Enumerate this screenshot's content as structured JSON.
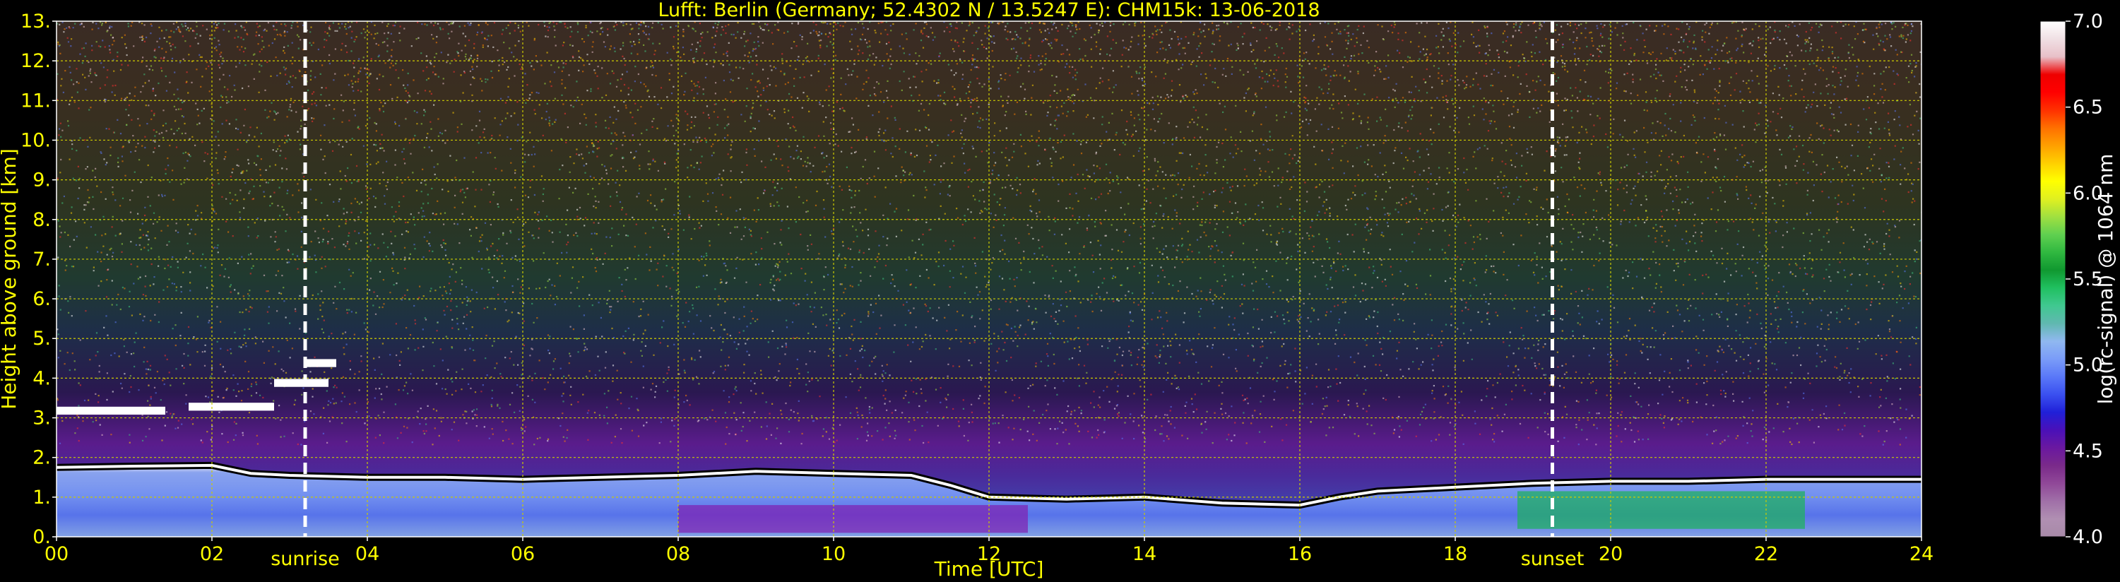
{
  "chart_data": {
    "type": "heatmap",
    "title": "Lufft: Berlin (Germany; 52.4302 N / 13.5247 E):    CHM15k: 13-06-2018",
    "xlabel": "Time [UTC]",
    "ylabel": "Height above ground [km]",
    "xlim": [
      0,
      24
    ],
    "ylim": [
      0,
      13
    ],
    "x_ticks": [
      "00",
      "02",
      "04",
      "06",
      "08",
      "10",
      "12",
      "14",
      "16",
      "18",
      "20",
      "22",
      "24"
    ],
    "y_ticks": [
      "0.",
      "1.",
      "2.",
      "3.",
      "4.",
      "5.",
      "6.",
      "7.",
      "8.",
      "9.",
      "10.",
      "11.",
      "12.",
      "13."
    ],
    "grid": true,
    "annotations": [
      {
        "label": "sunrise",
        "x": 3.2
      },
      {
        "label": "sunset",
        "x": 19.25
      }
    ],
    "colorbar": {
      "label": "log(rc-signal) @ 1064 nm",
      "range": [
        4.0,
        7.0
      ],
      "ticks": [
        "4.0",
        "4.5",
        "5.0",
        "5.5",
        "6.0",
        "6.5",
        "7.0"
      ],
      "colors": [
        "#a88aa8",
        "#b08fb2",
        "#a070a8",
        "#904898",
        "#7a2a8a",
        "#6a18a0",
        "#4a10b8",
        "#2020d8",
        "#3a50f0",
        "#5a78f8",
        "#7a9cf8",
        "#90b8f0",
        "#60b8b0",
        "#40c890",
        "#20c060",
        "#109830",
        "#30b840",
        "#60d050",
        "#a0e040",
        "#e0f020",
        "#ffff00",
        "#ffd000",
        "#ffa000",
        "#ff7000",
        "#ff3000",
        "#ff0000",
        "#ee0000",
        "#e8c0c8",
        "#f0e0e4",
        "#ffffff"
      ]
    },
    "features": {
      "boundary_layer_top_km": [
        [
          0,
          1.75
        ],
        [
          1,
          1.78
        ],
        [
          2,
          1.8
        ],
        [
          2.5,
          1.6
        ],
        [
          3,
          1.55
        ],
        [
          4,
          1.5
        ],
        [
          5,
          1.5
        ],
        [
          6,
          1.45
        ],
        [
          7,
          1.5
        ],
        [
          8,
          1.55
        ],
        [
          9,
          1.65
        ],
        [
          10,
          1.6
        ],
        [
          11,
          1.55
        ],
        [
          11.5,
          1.3
        ],
        [
          12,
          1.0
        ],
        [
          13,
          0.95
        ],
        [
          14,
          1.0
        ],
        [
          15,
          0.85
        ],
        [
          16,
          0.8
        ],
        [
          16.5,
          1.0
        ],
        [
          17,
          1.15
        ],
        [
          18,
          1.25
        ],
        [
          19,
          1.35
        ],
        [
          20,
          1.4
        ],
        [
          21,
          1.4
        ],
        [
          22,
          1.45
        ],
        [
          23,
          1.45
        ],
        [
          24,
          1.45
        ]
      ],
      "cloud_layer_km": [
        {
          "t0": 0.0,
          "t1": 1.4,
          "h": 3.2
        },
        {
          "t0": 1.7,
          "t1": 2.8,
          "h": 3.3
        },
        {
          "t0": 2.8,
          "t1": 3.5,
          "h": 3.9
        },
        {
          "t0": 3.2,
          "t1": 3.6,
          "h": 4.4
        }
      ]
    }
  }
}
